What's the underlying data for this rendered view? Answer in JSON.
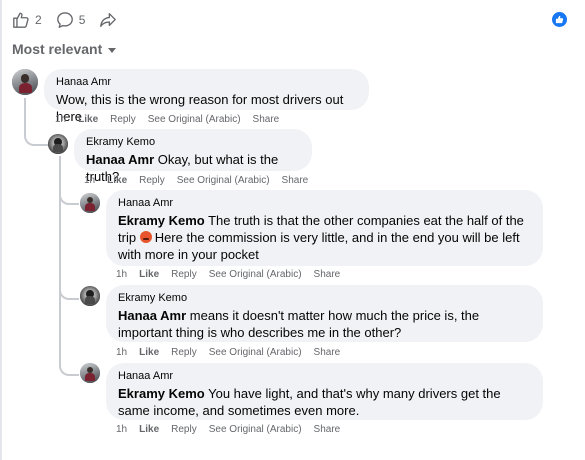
{
  "reactions": {
    "like_count": "2",
    "comment_count": "5"
  },
  "sort": {
    "label": "Most relevant"
  },
  "comments": [
    {
      "author": "Hanaa Amr",
      "mention": "",
      "text": "Wow, this is the wrong reason for most drivers out here",
      "time": "1h",
      "like": "Like",
      "reply": "Reply",
      "see_original": "See Original (Arabic)",
      "share": "Share"
    },
    {
      "author": "Ekramy Kemo",
      "mention": "Hanaa Amr",
      "text": "Okay, but what is the truth?",
      "time": "1h",
      "like": "Like",
      "reply": "Reply",
      "see_original": "See Original (Arabic)",
      "share": "Share"
    },
    {
      "author": "Hanaa Amr",
      "mention": "Ekramy Kemo",
      "text_a": "The truth is that the other companies eat the half of the trip",
      "text_b": "Here the commission is very little, and in the end you will be left with more in your pocket",
      "time": "1h",
      "like": "Like",
      "reply": "Reply",
      "see_original": "See Original (Arabic)",
      "share": "Share"
    },
    {
      "author": "Ekramy Kemo",
      "mention": "Hanaa Amr",
      "text": "means it doesn't matter how much the price is, the important thing is who describes me in the other?",
      "time": "1h",
      "like": "Like",
      "reply": "Reply",
      "see_original": "See Original (Arabic)",
      "share": "Share"
    },
    {
      "author": "Hanaa Amr",
      "mention": "Ekramy Kemo",
      "text": "You have light, and that's why many drivers get the same income, and sometimes even more.",
      "time": "1h",
      "like": "Like",
      "reply": "Reply",
      "see_original": "See Original (Arabic)",
      "share": "Share"
    }
  ],
  "colors": {
    "bubble": "#f0f2f5",
    "meta": "#65676b",
    "brand": "#1877f2",
    "thread_line": "#c8ccd1"
  },
  "icons": [
    "thumbs-up-icon",
    "comment-icon",
    "share-icon",
    "facebook-like-badge-icon",
    "caret-down-icon"
  ]
}
